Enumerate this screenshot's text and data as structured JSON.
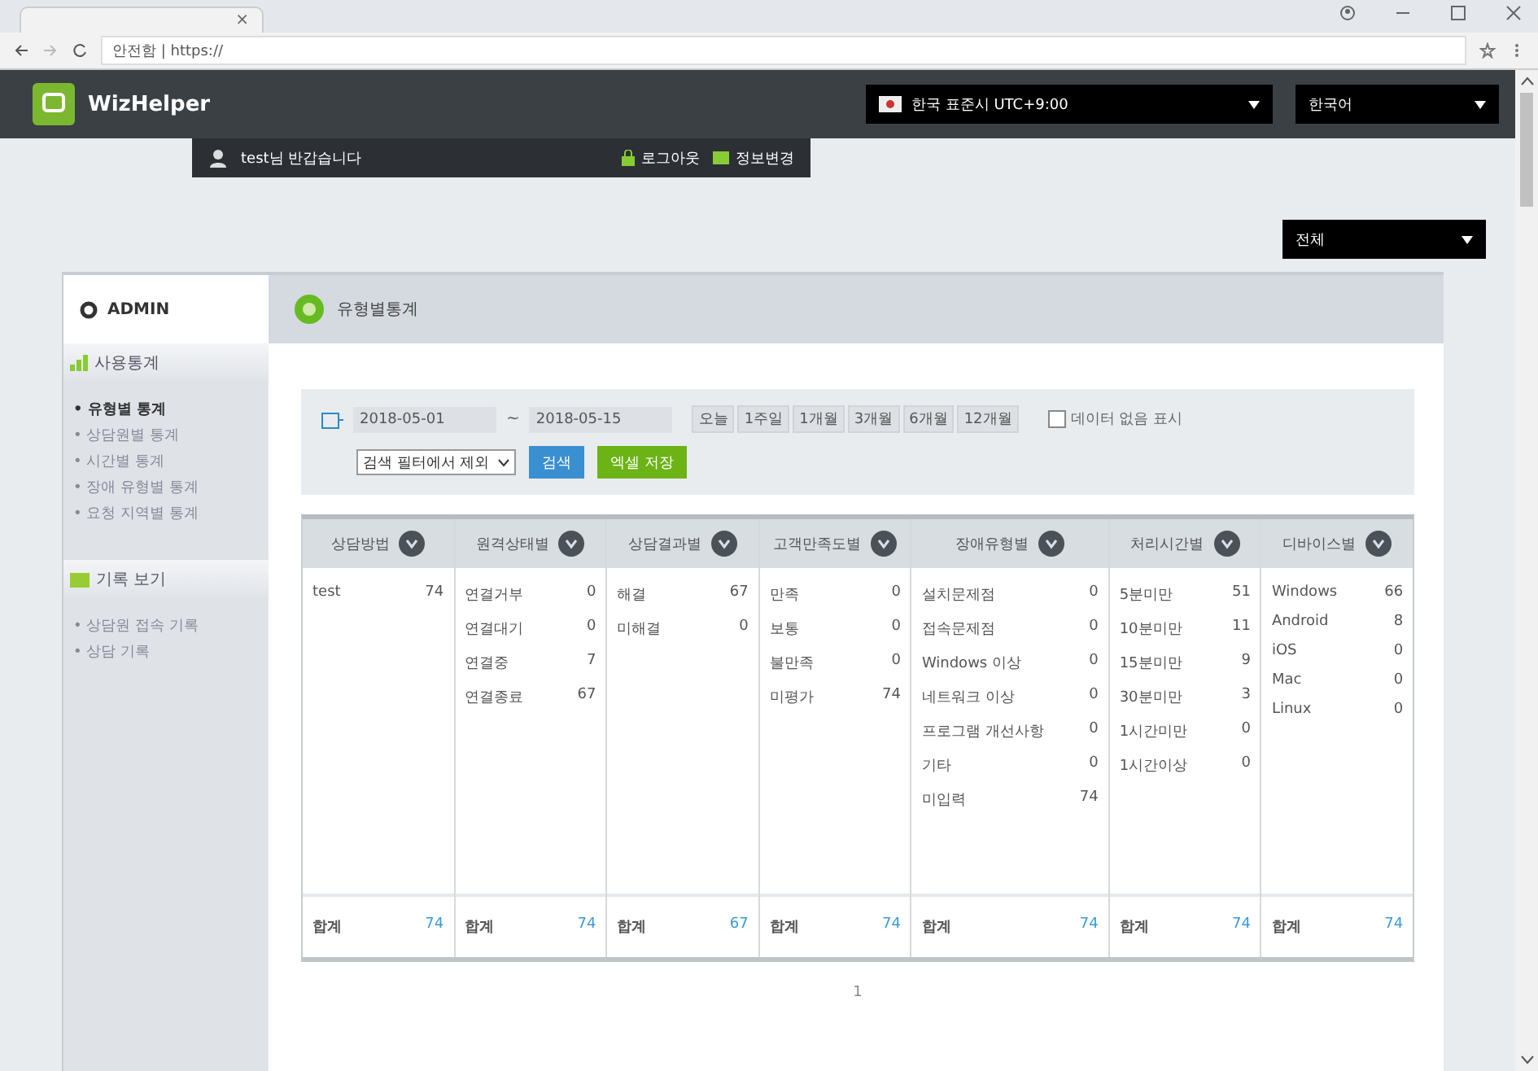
{
  "browser": {
    "tab_title": "×",
    "address": "안전함 | https://"
  },
  "header": {
    "logo": "WizHelper",
    "timezone": "한국 표준시 UTC+9:00",
    "language": "한국어"
  },
  "user_bar": {
    "greeting": "test님 반갑습니다",
    "logout": "로그아웃",
    "edit": "정보변경"
  },
  "scope_select": "전체",
  "sidebar": {
    "title": "ADMIN",
    "sections": [
      {
        "title": "사용통계",
        "items": [
          {
            "label": "• 유형별 통계",
            "selected": true
          },
          {
            "label": "• 상담원별 통계",
            "selected": false
          },
          {
            "label": "• 시간별 통계",
            "selected": false
          },
          {
            "label": "• 장애 유형별 통계",
            "selected": false
          },
          {
            "label": "• 요청 지역별 통계",
            "selected": false
          }
        ]
      },
      {
        "title": "기록 보기",
        "items": [
          {
            "label": "• 상담원 접속 기록",
            "selected": false
          },
          {
            "label": "• 상담 기록",
            "selected": false
          }
        ]
      }
    ]
  },
  "page_title": "유형별통계",
  "filter": {
    "date_from": "2018-05-01",
    "date_to": "2018-05-15",
    "separator": "~",
    "periods": [
      "오늘",
      "1주일",
      "1개월",
      "3개월",
      "6개월",
      "12개월"
    ],
    "show_empty": {
      "label": "데이터 없음 표시",
      "checked": false
    },
    "exclude_select": "검색 필터에서 제외",
    "search": "검색",
    "excel": "엑셀 저장"
  },
  "table": {
    "columns": [
      {
        "title": "상담방법",
        "rows": [
          [
            "test",
            "74"
          ]
        ],
        "total_label": "합계",
        "total": "74"
      },
      {
        "title": "원격상태별",
        "rows": [
          [
            "연결거부",
            "0"
          ],
          [
            "연결대기",
            "0"
          ],
          [
            "연결중",
            "7"
          ],
          [
            "연결종료",
            "67"
          ]
        ],
        "total_label": "합계",
        "total": "74"
      },
      {
        "title": "상담결과별",
        "rows": [
          [
            "해결",
            "67"
          ],
          [
            "미해결",
            "0"
          ]
        ],
        "total_label": "합계",
        "total": "67"
      },
      {
        "title": "고객만족도별",
        "rows": [
          [
            "만족",
            "0"
          ],
          [
            "보통",
            "0"
          ],
          [
            "불만족",
            "0"
          ],
          [
            "미평가",
            "74"
          ]
        ],
        "total_label": "합계",
        "total": "74"
      },
      {
        "title": "장애유형별",
        "rows": [
          [
            "설치문제점",
            "0"
          ],
          [
            "접속문제점",
            "0"
          ],
          [
            "Windows 이상",
            "0"
          ],
          [
            "네트워크 이상",
            "0"
          ],
          [
            "프로그램 개선사항",
            "0"
          ],
          [
            "기타",
            "0"
          ],
          [
            "미입력",
            "74"
          ]
        ],
        "total_label": "합계",
        "total": "74"
      },
      {
        "title": "처리시간별",
        "rows": [
          [
            "5분미만",
            "51"
          ],
          [
            "10분미만",
            "11"
          ],
          [
            "15분미만",
            "9"
          ],
          [
            "30분미만",
            "3"
          ],
          [
            "1시간미만",
            "0"
          ],
          [
            "1시간이상",
            "0"
          ]
        ],
        "total_label": "합계",
        "total": "74"
      },
      {
        "title": "디바이스별",
        "rows": [
          [
            "Windows",
            "66"
          ],
          [
            "Android",
            "8"
          ],
          [
            "iOS",
            "0"
          ],
          [
            "Mac",
            "0"
          ],
          [
            "Linux",
            "0"
          ]
        ],
        "total_label": "합계",
        "total": "74"
      }
    ]
  },
  "pagination": [
    "1"
  ]
}
